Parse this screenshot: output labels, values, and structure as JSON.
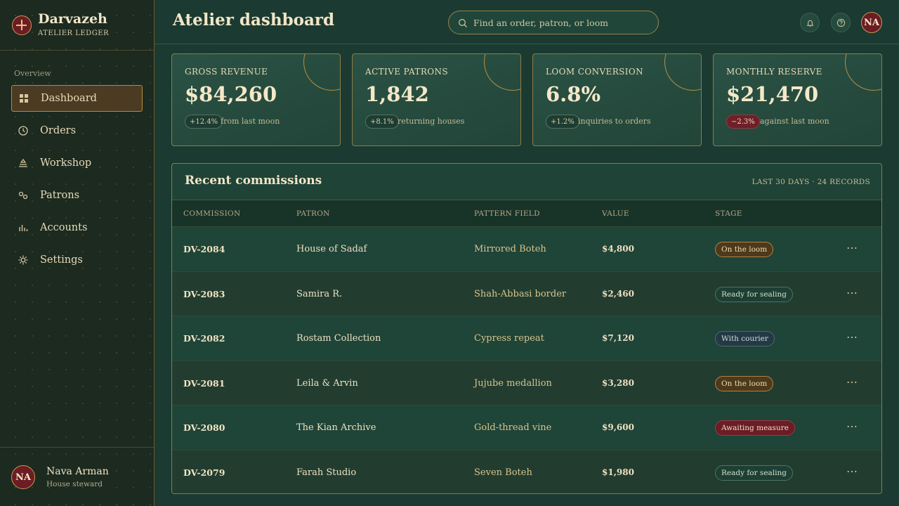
{
  "brand": {
    "name": "Darvazeh",
    "subtitle": "ATELIER LEDGER"
  },
  "sidebar": {
    "section": "Overview",
    "items": [
      {
        "label": "Dashboard",
        "icon": "grid-icon",
        "active": true
      },
      {
        "label": "Orders",
        "icon": "clock-icon"
      },
      {
        "label": "Workshop",
        "icon": "loom-icon"
      },
      {
        "label": "Patrons",
        "icon": "people-icon"
      },
      {
        "label": "Accounts",
        "icon": "bar-chart-icon"
      },
      {
        "label": "Settings",
        "icon": "gear-icon"
      }
    ]
  },
  "user": {
    "initials": "NA",
    "name": "Nava Arman",
    "role": "House steward"
  },
  "header": {
    "title": "Atelier dashboard",
    "search_placeholder": "Find an order, patron, or loom",
    "avatar_initials": "NA"
  },
  "kpis": [
    {
      "label": "GROSS REVENUE",
      "value": "$84,260",
      "delta": "+12.4%",
      "note": "from last moon",
      "negative": false
    },
    {
      "label": "ACTIVE PATRONS",
      "value": "1,842",
      "delta": "+8.1%",
      "note": "returning houses",
      "negative": false
    },
    {
      "label": "LOOM CONVERSION",
      "value": "6.8%",
      "delta": "+1.2%",
      "note": "inquiries to orders",
      "negative": false
    },
    {
      "label": "MONTHLY RESERVE",
      "value": "$21,470",
      "delta": "−2.3%",
      "note": "against last moon",
      "negative": true
    }
  ],
  "table": {
    "title": "Recent commissions",
    "meta": "LAST 30 DAYS · 24 RECORDS",
    "columns": [
      "COMMISSION",
      "PATRON",
      "PATTERN FIELD",
      "VALUE",
      "STAGE"
    ],
    "rows": [
      {
        "id": "DV-2084",
        "patron": "House of Sadaf",
        "pattern": "Mirrored Boteh",
        "value": "$4,800",
        "stage": "On the loom",
        "stage_type": "loom"
      },
      {
        "id": "DV-2083",
        "patron": "Samira R.",
        "pattern": "Shah-Abbasi border",
        "value": "$2,460",
        "stage": "Ready for sealing",
        "stage_type": "seal"
      },
      {
        "id": "DV-2082",
        "patron": "Rostam Collection",
        "pattern": "Cypress repeat",
        "value": "$7,120",
        "stage": "With courier",
        "stage_type": "courier"
      },
      {
        "id": "DV-2081",
        "patron": "Leila & Arvin",
        "pattern": "Jujube medallion",
        "value": "$3,280",
        "stage": "On the loom",
        "stage_type": "loom"
      },
      {
        "id": "DV-2080",
        "patron": "The Kian Archive",
        "pattern": "Gold-thread vine",
        "value": "$9,600",
        "stage": "Awaiting measure",
        "stage_type": "await"
      },
      {
        "id": "DV-2079",
        "patron": "Farah Studio",
        "pattern": "Seven Boteh",
        "value": "$1,980",
        "stage": "Ready for sealing",
        "stage_type": "seal"
      }
    ]
  },
  "colors": {
    "accent": "#c89a4e",
    "crimson": "#6b1c24",
    "background": "#1b3a31"
  }
}
